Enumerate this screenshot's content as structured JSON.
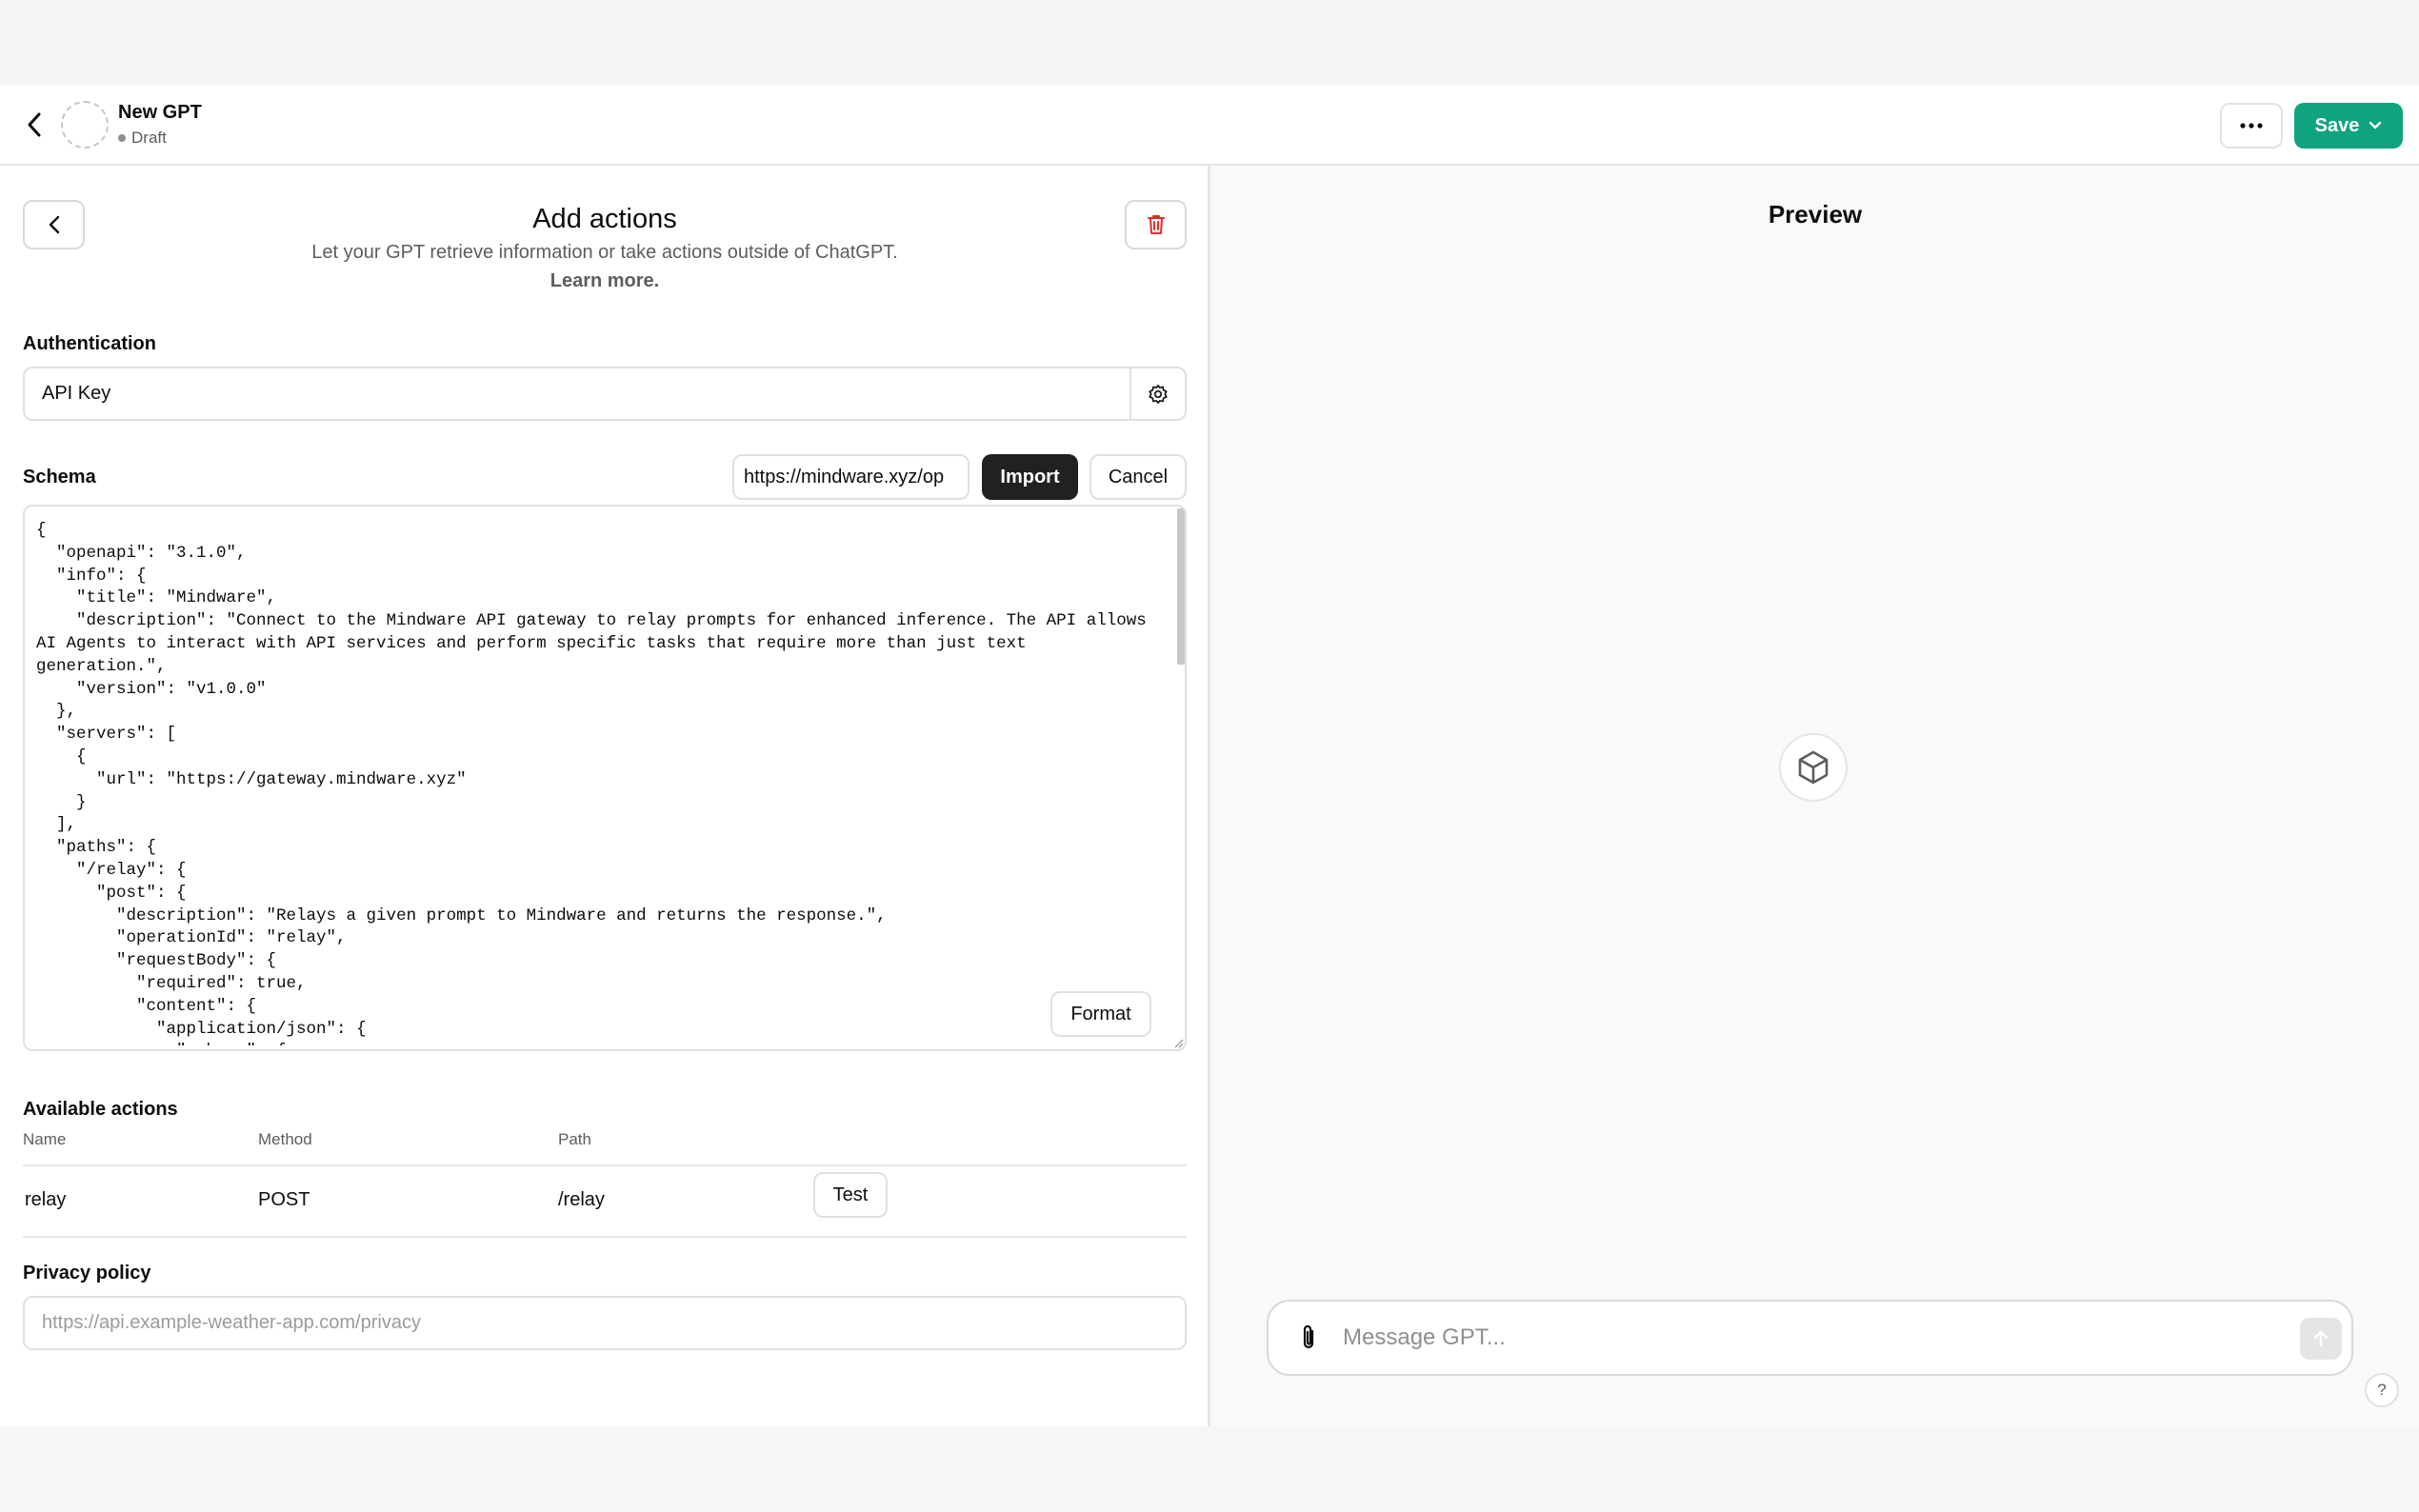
{
  "header": {
    "gpt_name": "New GPT",
    "gpt_status": "Draft",
    "save_label": "Save"
  },
  "editor": {
    "title": "Add actions",
    "subtitle": "Let your GPT retrieve information or take actions outside of ChatGPT.",
    "learn_more": "Learn more.",
    "authentication": {
      "label": "Authentication",
      "value": "API Key"
    },
    "schema": {
      "label": "Schema",
      "import_url": "https://mindware.xyz/op",
      "import_label": "Import",
      "cancel_label": "Cancel",
      "format_label": "Format",
      "content": "{\n  \"openapi\": \"3.1.0\",\n  \"info\": {\n    \"title\": \"Mindware\",\n    \"description\": \"Connect to the Mindware API gateway to relay prompts for enhanced inference. The API allows AI Agents to interact with API services and perform specific tasks that require more than just text generation.\",\n    \"version\": \"v1.0.0\"\n  },\n  \"servers\": [\n    {\n      \"url\": \"https://gateway.mindware.xyz\"\n    }\n  ],\n  \"paths\": {\n    \"/relay\": {\n      \"post\": {\n        \"description\": \"Relays a given prompt to Mindware and returns the response.\",\n        \"operationId\": \"relay\",\n        \"requestBody\": {\n          \"required\": true,\n          \"content\": {\n            \"application/json\": {\n              \"schema\": {"
    },
    "available_actions": {
      "label": "Available actions",
      "columns": [
        "Name",
        "Method",
        "Path"
      ],
      "rows": [
        {
          "name": "relay",
          "method": "POST",
          "path": "/relay",
          "test_label": "Test"
        }
      ]
    },
    "privacy_policy": {
      "label": "Privacy policy",
      "placeholder": "https://api.example-weather-app.com/privacy"
    }
  },
  "preview": {
    "title": "Preview",
    "message_placeholder": "Message GPT...",
    "help_label": "?"
  },
  "colors": {
    "accent": "#10a37f",
    "import_button": "#202123",
    "delete_icon": "#e02e2a"
  },
  "icons": {
    "back": "chevron-left-icon",
    "more": "ellipsis-icon",
    "save_dropdown": "chevron-down-icon",
    "delete": "trash-icon",
    "auth_settings": "gear-icon",
    "preview_avatar": "cube-icon",
    "attach": "paperclip-icon",
    "send": "arrow-up-icon"
  }
}
